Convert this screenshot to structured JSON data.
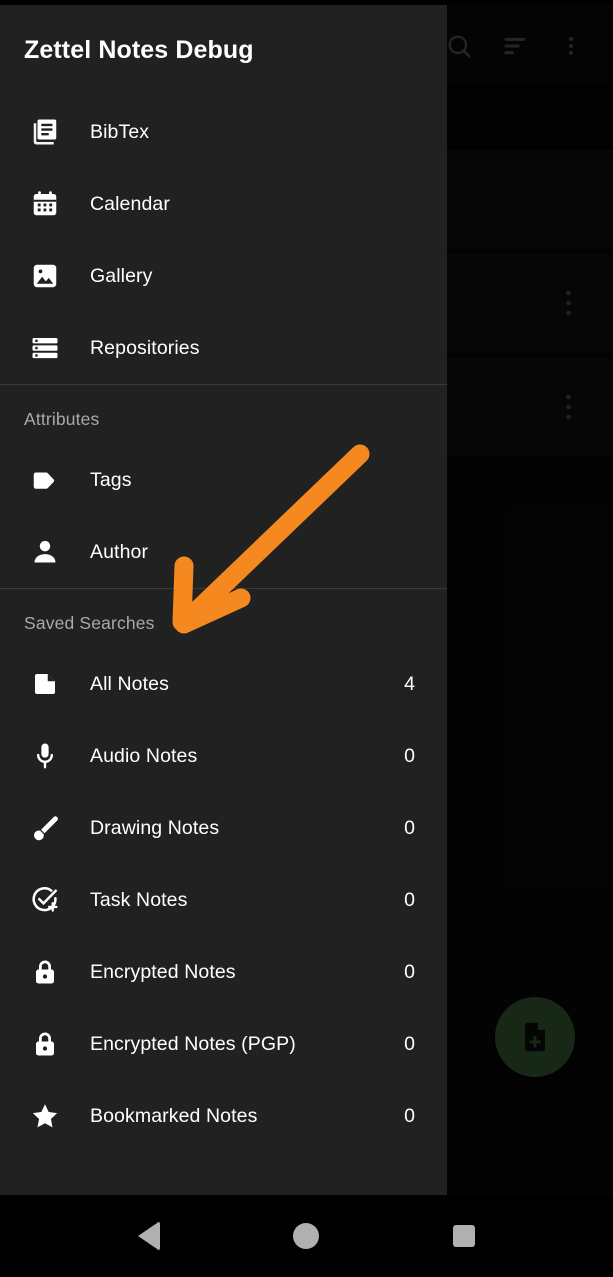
{
  "app": {
    "drawer_title": "Zettel Notes Debug",
    "accent_color": "#3e6b3c",
    "drawer_bg": "#212121",
    "annotation_color": "#f5891f"
  },
  "toolbar": {
    "items": [
      {
        "name": "search-icon",
        "label": "Search"
      },
      {
        "name": "sort-icon",
        "label": "Sort"
      },
      {
        "name": "overflow-menu-icon",
        "label": "More options"
      }
    ]
  },
  "fab": {
    "label": "New note",
    "icon": "note-add-icon"
  },
  "drawer": {
    "primary": {
      "items": [
        {
          "label": "BibTex",
          "icon": "bibtex-icon"
        },
        {
          "label": "Calendar",
          "icon": "calendar-icon"
        },
        {
          "label": "Gallery",
          "icon": "gallery-icon"
        },
        {
          "label": "Repositories",
          "icon": "repositories-icon"
        }
      ]
    },
    "attributes": {
      "label": "Attributes",
      "items": [
        {
          "label": "Tags",
          "icon": "tag-icon"
        },
        {
          "label": "Author",
          "icon": "person-icon"
        }
      ]
    },
    "saved_searches": {
      "label": "Saved Searches",
      "items": [
        {
          "label": "All Notes",
          "icon": "note-icon",
          "count": "4"
        },
        {
          "label": "Audio Notes",
          "icon": "microphone-icon",
          "count": "0"
        },
        {
          "label": "Drawing Notes",
          "icon": "brush-icon",
          "count": "0"
        },
        {
          "label": "Task Notes",
          "icon": "task-add-icon",
          "count": "0"
        },
        {
          "label": "Encrypted Notes",
          "icon": "lock-icon",
          "count": "0"
        },
        {
          "label": "Encrypted Notes (PGP)",
          "icon": "lock-icon",
          "count": "0"
        },
        {
          "label": "Bookmarked Notes",
          "icon": "star-icon",
          "count": "0"
        }
      ]
    }
  },
  "background_list": {
    "cards": [
      {
        "has_overflow": false
      },
      {
        "has_overflow": false
      },
      {
        "has_overflow": true
      },
      {
        "has_overflow": true
      }
    ]
  },
  "system_nav": {
    "back": "Back",
    "home": "Home",
    "recents": "Recent apps"
  }
}
